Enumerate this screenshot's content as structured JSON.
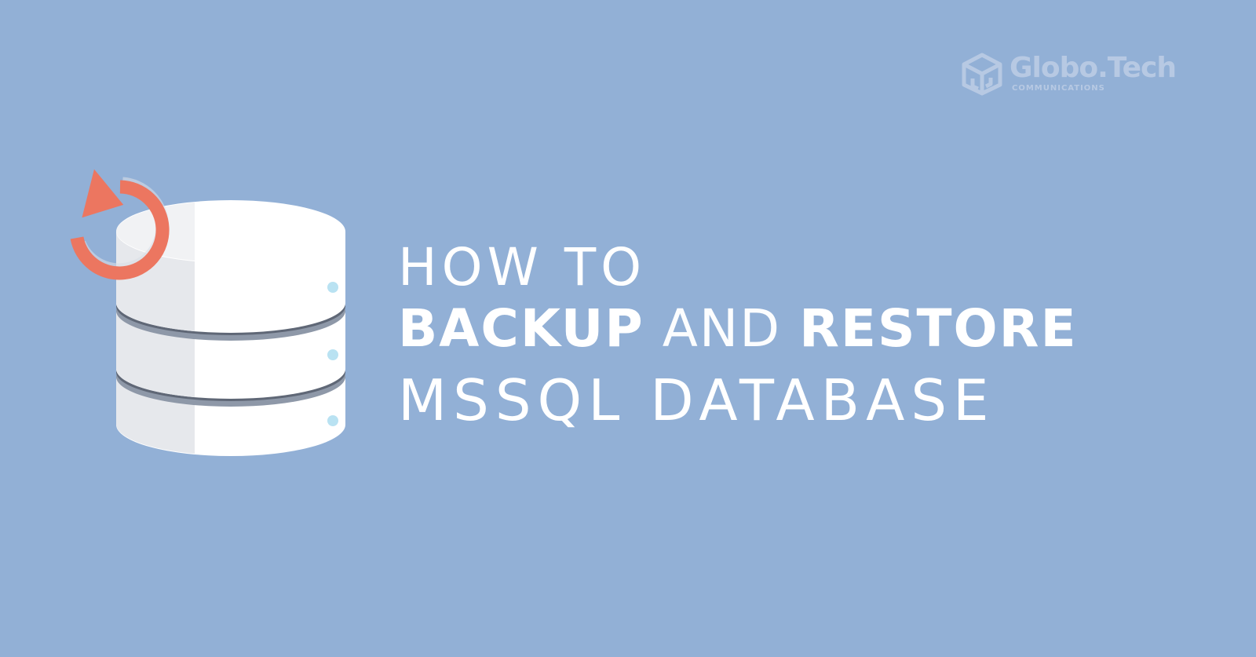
{
  "logo": {
    "name": "Globo.Tech",
    "subtitle": "COMMUNICATIONS",
    "icon": "cube-g-logo-icon"
  },
  "illustration": {
    "icon": "database-restore-icon",
    "arrow_icon": "counterclockwise-arrow-icon"
  },
  "headline": {
    "line1": "HOW TO",
    "line2_word1": "BACKUP",
    "line2_word2": "AND",
    "line2_word3": "RESTORE",
    "line3": "MSSQL DATABASE"
  },
  "colors": {
    "background": "#92b0d6",
    "arrow": "#ec7660",
    "text": "#ffffff",
    "logo": "#b7c9e3",
    "database_dots": "#b9e2f2"
  }
}
